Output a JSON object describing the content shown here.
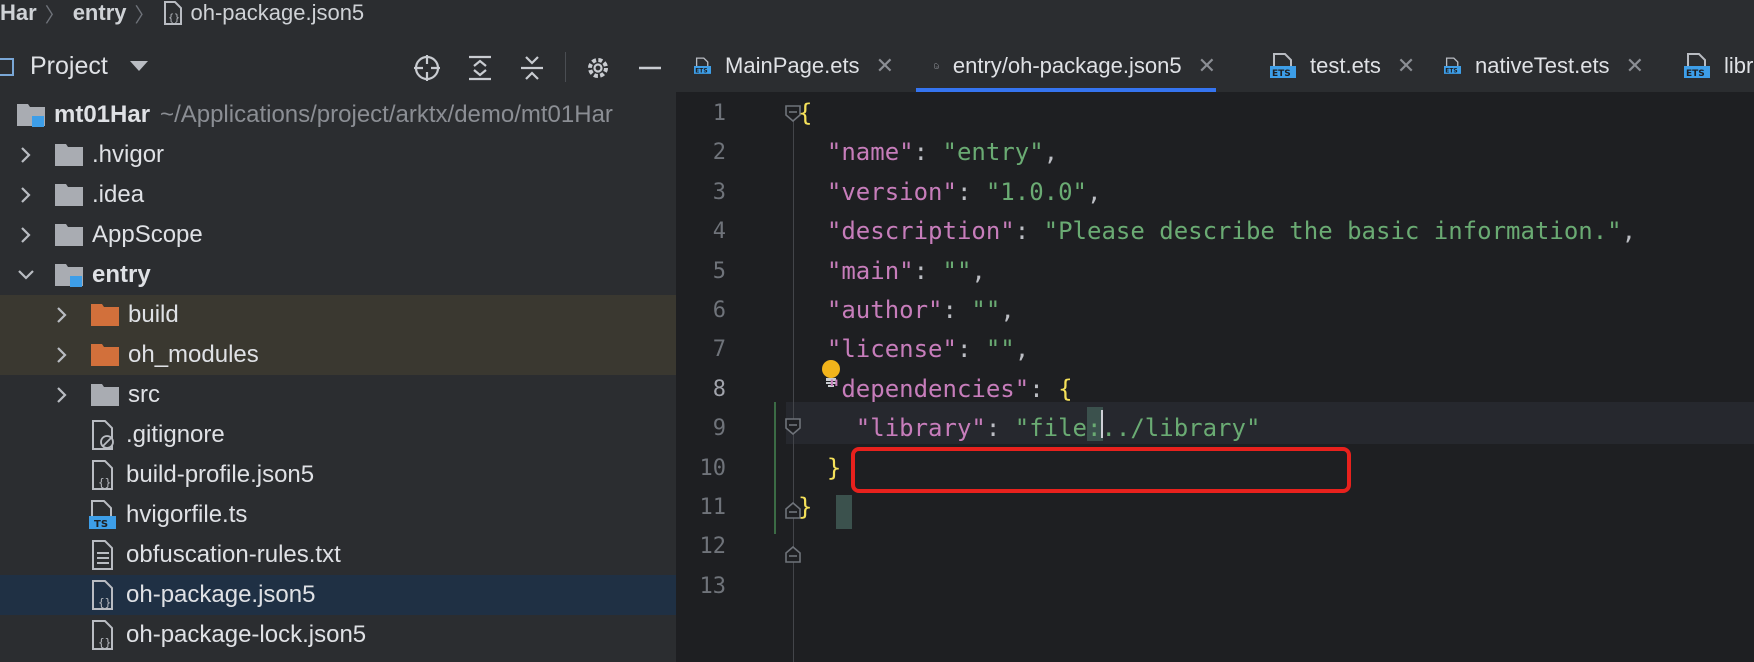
{
  "breadcrumb": {
    "items": [
      "Har",
      "entry",
      "oh-package.json5"
    ]
  },
  "project_panel": {
    "title": "Project",
    "tree": [
      {
        "label": "mt01Har",
        "path": "~/Applications/project/arktx/demo/mt01Har",
        "kind": "module-root",
        "expanded": true
      },
      {
        "label": ".hvigor",
        "kind": "folder",
        "expanded": false
      },
      {
        "label": ".idea",
        "kind": "folder",
        "expanded": false
      },
      {
        "label": "AppScope",
        "kind": "folder",
        "expanded": false
      },
      {
        "label": "entry",
        "kind": "module",
        "expanded": true
      },
      {
        "label": "build",
        "kind": "excluded-folder",
        "expanded": false
      },
      {
        "label": "oh_modules",
        "kind": "excluded-folder",
        "expanded": false
      },
      {
        "label": "src",
        "kind": "folder",
        "expanded": false
      },
      {
        "label": ".gitignore",
        "kind": "ignore-file"
      },
      {
        "label": "build-profile.json5",
        "kind": "json-file"
      },
      {
        "label": "hvigorfile.ts",
        "kind": "ts-file"
      },
      {
        "label": "obfuscation-rules.txt",
        "kind": "text-file"
      },
      {
        "label": "oh-package.json5",
        "kind": "json-file",
        "selected": true
      },
      {
        "label": "oh-package-lock.json5",
        "kind": "json-file"
      }
    ]
  },
  "tabs": [
    {
      "label": "MainPage.ets",
      "icon": "ets-file-icon"
    },
    {
      "label": "entry/oh-package.json5",
      "icon": "json-file-icon",
      "active": true
    },
    {
      "label": "test.ets",
      "icon": "ets-file-icon"
    },
    {
      "label": "nativeTest.ets",
      "icon": "ets-file-icon"
    },
    {
      "label": "libr",
      "icon": "ets-file-icon"
    }
  ],
  "tab_icon_text": "ETS",
  "ts_icon_text": "TS",
  "close_glyph": "✕",
  "editor": {
    "current_line": 8,
    "line_numbers": [
      "1",
      "2",
      "3",
      "4",
      "5",
      "6",
      "7",
      "8",
      "9",
      "10",
      "11",
      "12",
      "13"
    ],
    "lines": [
      {
        "t": [
          [
            "{",
            "br"
          ]
        ]
      },
      {
        "t": [
          [
            "  ",
            ""
          ],
          [
            "\"name\"",
            "k"
          ],
          [
            ": ",
            ""
          ],
          [
            "\"entry\"",
            "s"
          ],
          [
            ",",
            ""
          ]
        ]
      },
      {
        "t": [
          [
            "  ",
            ""
          ],
          [
            "\"version\"",
            "k"
          ],
          [
            ": ",
            ""
          ],
          [
            "\"1.0.0\"",
            "s"
          ],
          [
            ",",
            ""
          ]
        ]
      },
      {
        "t": [
          [
            "  ",
            ""
          ],
          [
            "\"description\"",
            "k"
          ],
          [
            ": ",
            ""
          ],
          [
            "\"Please describe the basic information.\"",
            "s"
          ],
          [
            ",",
            ""
          ]
        ]
      },
      {
        "t": [
          [
            "  ",
            ""
          ],
          [
            "\"main\"",
            "k"
          ],
          [
            ": ",
            ""
          ],
          [
            "\"\"",
            "s"
          ],
          [
            ",",
            ""
          ]
        ]
      },
      {
        "t": [
          [
            "  ",
            ""
          ],
          [
            "\"author\"",
            "k"
          ],
          [
            ": ",
            ""
          ],
          [
            "\"\"",
            "s"
          ],
          [
            ",",
            ""
          ]
        ]
      },
      {
        "t": [
          [
            "  ",
            ""
          ],
          [
            "\"license\"",
            "k"
          ],
          [
            ": ",
            ""
          ],
          [
            "\"\"",
            "s"
          ],
          [
            ",",
            ""
          ]
        ]
      },
      {
        "t": [
          [
            "  ",
            ""
          ],
          [
            "\"dependencies\"",
            "k"
          ],
          [
            ": ",
            ""
          ],
          [
            "{",
            "br"
          ]
        ]
      },
      {
        "t": [
          [
            "    ",
            ""
          ],
          [
            "\"library\"",
            "k"
          ],
          [
            ": ",
            ""
          ],
          [
            "\"file:../library\"",
            "s"
          ]
        ]
      },
      {
        "t": [
          [
            "  ",
            ""
          ],
          [
            "}",
            "br"
          ]
        ]
      },
      {
        "t": [
          [
            "}",
            "br"
          ]
        ]
      },
      {
        "t": []
      },
      {
        "t": []
      }
    ]
  },
  "colors": {
    "accent": "#3574f0",
    "highlight_box": "#e8211d",
    "folder": "#a9acb2",
    "excluded_folder": "#d2703b",
    "module_blue": "#3d9ee8"
  }
}
